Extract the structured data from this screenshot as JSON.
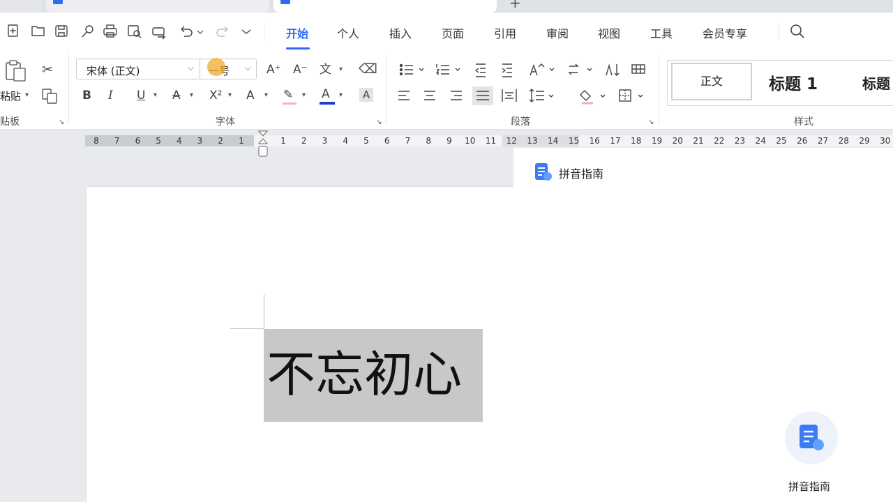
{
  "tabs": [
    {
      "label": "",
      "active": false
    },
    {
      "label": "",
      "active": false
    },
    {
      "label": "",
      "active": true
    }
  ],
  "menu_tabs": [
    "开始",
    "个人",
    "插入",
    "页面",
    "引用",
    "审阅",
    "视图",
    "工具",
    "会员专享"
  ],
  "active_menu": "开始",
  "ribbon": {
    "paste_label": "粘贴",
    "clipboard_group": "贴板",
    "font_name": "宋体 (正文)",
    "font_size": "一号",
    "font_group": "字体",
    "paragraph_group": "段落",
    "styles_group": "样式",
    "style_normal": "正文",
    "style_heading1": "标题 1",
    "style_heading2": "标题"
  },
  "ruler": {
    "left_numbers": [
      "8",
      "7",
      "6",
      "5",
      "4",
      "3",
      "2",
      "1"
    ],
    "right_numbers": [
      "1",
      "2",
      "3",
      "4",
      "5",
      "6",
      "7",
      "8",
      "9",
      "10",
      "11",
      "12",
      "13",
      "14",
      "15",
      "16",
      "17",
      "18",
      "19",
      "20",
      "21",
      "22",
      "23",
      "24",
      "25",
      "26",
      "27",
      "28",
      "29",
      "30"
    ]
  },
  "document": {
    "selected_text": "不忘初心"
  },
  "side_panel": {
    "title": "拼音指南",
    "fab_label": "拼音指南"
  },
  "colors": {
    "accent": "#2f6cf3",
    "selection": "#c8c8c8",
    "font_color_bar": "#1f3ec7"
  }
}
